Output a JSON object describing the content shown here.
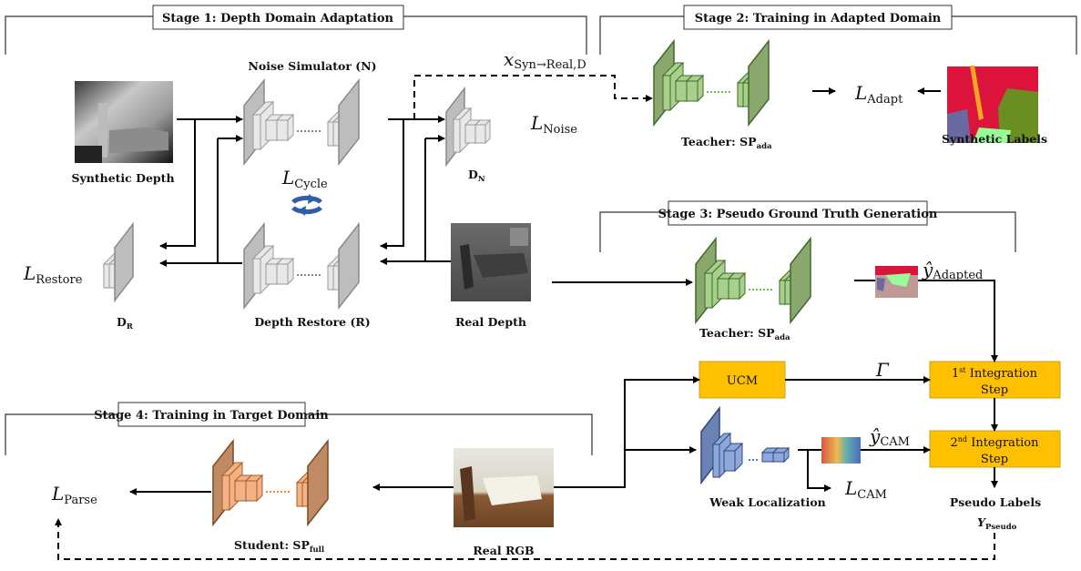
{
  "stages": {
    "stage1": "Stage 1: Depth Domain Adaptation",
    "stage2": "Stage 2: Training in Adapted Domain",
    "stage3": "Stage 3: Pseudo Ground Truth Generation",
    "stage4": "Stage 4: Training in Target Domain"
  },
  "labels": {
    "synthetic_depth": "Synthetic Depth",
    "noise_simulator": "Noise Simulator (N)",
    "depth_restore": "Depth Restore (R)",
    "real_depth": "Real Depth",
    "d_n_main": "D",
    "d_n_sub": "N",
    "d_r_main": "D",
    "d_r_sub": "R",
    "teacher_main": "Teacher: SP",
    "teacher_sub": "ada",
    "synthetic_labels": "Synthetic Labels",
    "weak_localization": "Weak Localization",
    "pseudo_labels": "Pseudo Labels",
    "y_pseudo_main": "Y",
    "y_pseudo_sub": "Pseudo",
    "student_main": "Student: SP",
    "student_sub": "full",
    "real_rgb": "Real RGB"
  },
  "math": {
    "l_noise_main": "L",
    "l_noise_sub": "Noise",
    "l_cycle_main": "L",
    "l_cycle_sub": "Cycle",
    "l_restore_main": "L",
    "l_restore_sub": "Restore",
    "l_adapt_main": "L",
    "l_adapt_sub": "Adapt",
    "l_cam_main": "L",
    "l_cam_sub": "CAM",
    "l_parse_main": "L",
    "l_parse_sub": "Parse",
    "x_syn_main": "x",
    "x_syn_sub": "Syn→Real,D",
    "y_adapted_main": "ŷ",
    "y_adapted_sub": "Adapted",
    "y_cam_main": "ŷ",
    "y_cam_sub": "CAM",
    "gamma": "Γ"
  },
  "boxes": {
    "ucm": "UCM",
    "int1_ord": "1",
    "int1_sup": "st",
    "int1_rest": " Integration",
    "int2_ord": "2",
    "int2_sup": "nd",
    "int2_rest": " Integration",
    "step": "Step"
  },
  "colors": {
    "gray_net": "#bdbdbd",
    "green_net": "#8aa86e",
    "blue_net": "#6b82b5",
    "orange_net": "#c08a64",
    "box_fill": "#ffc000",
    "box_stroke": "#c9a227",
    "cycle_icon": "#2f5fa8"
  }
}
